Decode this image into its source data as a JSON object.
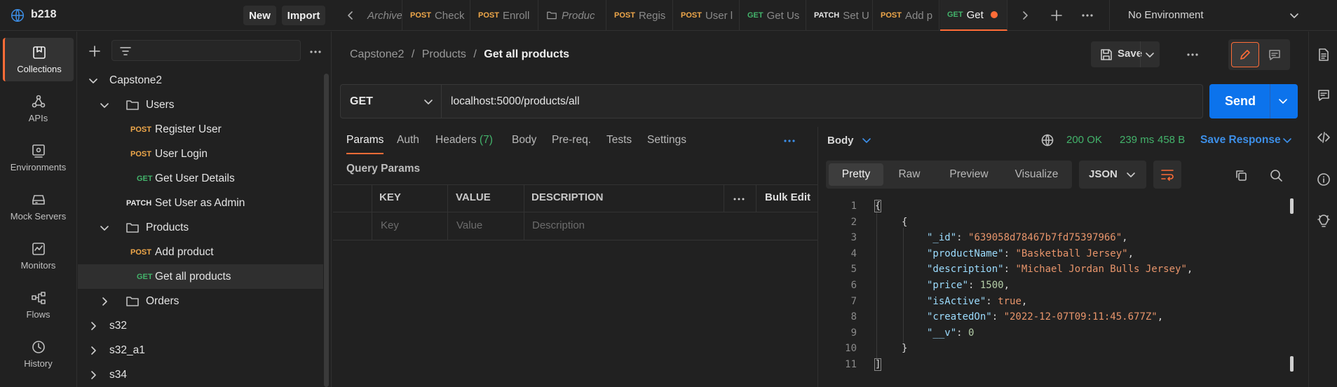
{
  "workspace": {
    "name": "b218",
    "new_label": "New",
    "import_label": "Import"
  },
  "tabs": [
    {
      "method": "",
      "label": "Archive",
      "italic": true
    },
    {
      "method": "POST",
      "label": "Check"
    },
    {
      "method": "POST",
      "label": "Enroll"
    },
    {
      "method": "",
      "label": "Produc",
      "italic": true
    },
    {
      "method": "POST",
      "label": "Regis"
    },
    {
      "method": "POST",
      "label": "User l"
    },
    {
      "method": "GET",
      "label": "Get Us"
    },
    {
      "method": "PATCH",
      "label": "Set U"
    },
    {
      "method": "POST",
      "label": "Add p"
    },
    {
      "method": "GET",
      "label": "Get"
    }
  ],
  "environment": {
    "label": "No Environment"
  },
  "rail": [
    {
      "label": "Collections",
      "icon": "collections-icon"
    },
    {
      "label": "APIs",
      "icon": "apis-icon"
    },
    {
      "label": "Environments",
      "icon": "environments-icon"
    },
    {
      "label": "Mock Servers",
      "icon": "mock-servers-icon"
    },
    {
      "label": "Monitors",
      "icon": "monitors-icon"
    },
    {
      "label": "Flows",
      "icon": "flows-icon"
    },
    {
      "label": "History",
      "icon": "history-icon"
    }
  ],
  "tree": {
    "collection": "Capstone2",
    "folder_users": "Users",
    "users_items": [
      {
        "method": "POST",
        "label": "Register User"
      },
      {
        "method": "POST",
        "label": "User Login"
      },
      {
        "method": "GET",
        "label": "Get User Details"
      }
    ],
    "patch_item": {
      "method": "PATCH",
      "label": "Set User as Admin"
    },
    "folder_products": "Products",
    "products_items": [
      {
        "method": "POST",
        "label": "Add product"
      },
      {
        "method": "GET",
        "label": "Get all products"
      }
    ],
    "folder_orders": "Orders",
    "other_collections": [
      "s32",
      "s32_a1",
      "s34"
    ]
  },
  "breadcrumb": {
    "parts": [
      "Capstone2",
      "Products"
    ],
    "sep": "/",
    "current": "Get all products"
  },
  "request": {
    "save_label": "Save",
    "method": "GET",
    "url": "localhost:5000/products/all",
    "send_label": "Send",
    "tabs": [
      {
        "label": "Params"
      },
      {
        "label": "Auth"
      },
      {
        "label": "Headers",
        "count": "(7)"
      },
      {
        "label": "Body"
      },
      {
        "label": "Pre-req."
      },
      {
        "label": "Tests"
      },
      {
        "label": "Settings"
      }
    ],
    "query_params_title": "Query Params",
    "table": {
      "headers": [
        "KEY",
        "VALUE",
        "DESCRIPTION"
      ],
      "bulk_edit": "Bulk Edit",
      "placeholders": [
        "Key",
        "Value",
        "Description"
      ]
    }
  },
  "response": {
    "body_label": "Body",
    "status": "200 OK",
    "time": "239 ms",
    "size": "458 B",
    "save_response": "Save Response",
    "view_tabs": [
      "Pretty",
      "Raw",
      "Preview",
      "Visualize"
    ],
    "format": "JSON",
    "line_numbers": [
      "1",
      "2",
      "3",
      "4",
      "5",
      "6",
      "7",
      "8",
      "9",
      "10",
      "11"
    ],
    "json": {
      "_id": "\"639058d78467b7fd75397966\"",
      "productName": "\"Basketball Jersey\"",
      "description": "\"Michael Jordan Bulls Jersey\"",
      "price": "1500",
      "isActive": "true",
      "createdOn": "\"2022-12-07T09:11:45.677Z\"",
      "__v": "0"
    }
  },
  "colors": {
    "accent": "#ff6c37",
    "send": "#0c73ec",
    "post": "#f0a84a",
    "get": "#43b36b",
    "link": "#3d8fe8"
  }
}
